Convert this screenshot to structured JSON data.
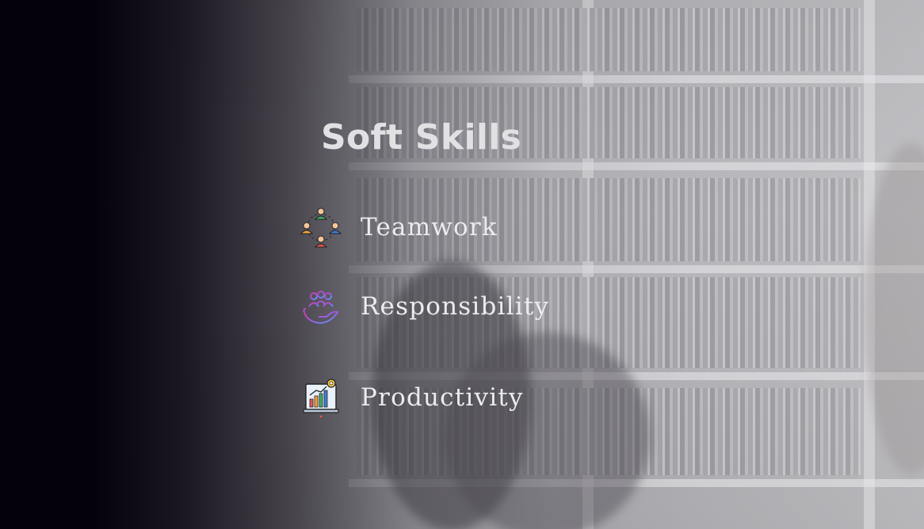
{
  "slide": {
    "title": "Soft Skills",
    "skills": [
      {
        "label": "Teamwork",
        "icon": "teamwork-network-icon"
      },
      {
        "label": "Responsibility",
        "icon": "hand-holding-people-icon"
      },
      {
        "label": "Productivity",
        "icon": "productivity-chart-laptop-icon"
      }
    ]
  },
  "colors": {
    "background_dark": "#04010c",
    "title_text": "#e1e1e3",
    "skill_text": "#ececee"
  }
}
